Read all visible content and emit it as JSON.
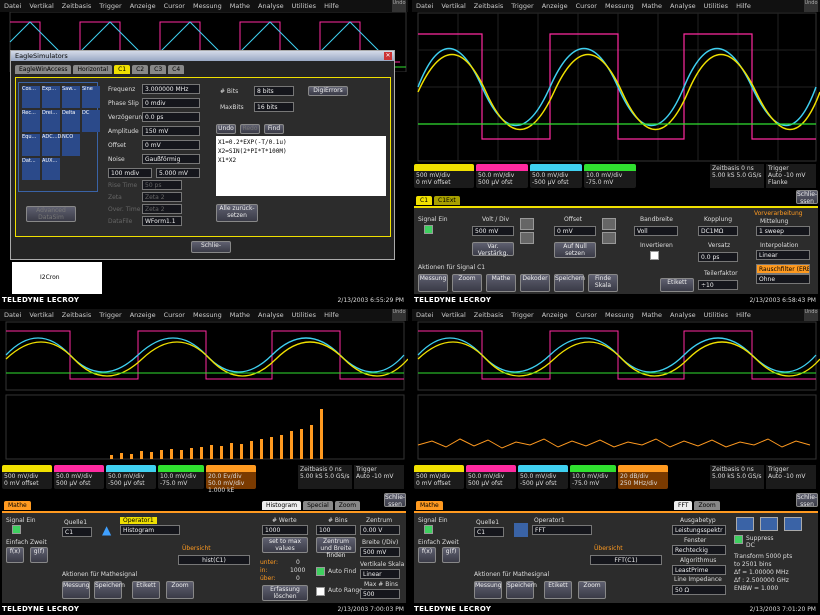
{
  "menu": [
    "Datei",
    "Vertikal",
    "Zeitbasis",
    "Trigger",
    "Anzeige",
    "Cursor",
    "Messung",
    "Mathe",
    "Analyse",
    "Utilities",
    "Hilfe"
  ],
  "undo": "Undo",
  "brand": "TELEDYNE LECROY",
  "colors": {
    "c1": "#f0e000",
    "c2": "#ff2aa0",
    "c3": "#3fd0f0",
    "c4": "#30e030",
    "math": "#ff9a20"
  },
  "timestamps": [
    "2/13/2003 6:55:29 PM",
    "2/13/2003 6:58:43 PM",
    "2/13/2003 7:00:03 PM",
    "2/13/2003 7:01:20 PM"
  ],
  "channels": [
    {
      "name": "C1",
      "coupling": "DC1M",
      "vdiv": "500 mV/div",
      "offset": "0 mV offset"
    },
    {
      "name": "C2",
      "coupling": "DC1M",
      "vdiv": "50.0 mV/div",
      "offset": "500 µV ofst"
    },
    {
      "name": "C3",
      "coupling": "DC1M",
      "vdiv": "50.0 mV/div",
      "offset": "-500 µV ofst"
    },
    {
      "name": "C4",
      "coupling": "DC1M",
      "vdiv": "10.0 mV/div",
      "offset": "-75.0 mV"
    }
  ],
  "timebase": {
    "label": "Zeitbasis",
    "value": "0 ns",
    "sr": "5.00 kS",
    "rate": "5.0 GS/s"
  },
  "trigger": {
    "label": "Trigger",
    "ch": "C1 DC",
    "mode": "Auto",
    "level": "-10 mV",
    "type": "Flanke",
    "slope": "Positiv"
  },
  "close_label": "Schlie-ssen",
  "q1": {
    "dialog_title": "EagleSimulators",
    "tabs": [
      "EagleWinAccess",
      "Horizontal",
      "C1",
      "C2",
      "C3",
      "C4"
    ],
    "wave_labels": [
      "Cos...",
      "Exp...",
      "Saw...",
      "Sine",
      "Rec...",
      "Drei...",
      "Delta",
      "DC",
      "Equ...",
      "ADC...Dat...",
      "NCO",
      "Dat...",
      "AUX..."
    ],
    "adv": "Advanced DataSim",
    "params": [
      {
        "label": "Frequenz",
        "value": "3.000000 MHz"
      },
      {
        "label": "Phase Slip",
        "value": "0 mdiv"
      },
      {
        "label": "Verzögerung",
        "value": "0.0 ps"
      },
      {
        "label": "Amplitude",
        "value": "150 mV"
      },
      {
        "label": "Offset",
        "value": "0 mV"
      },
      {
        "label": "Noise",
        "value": "Gaußförmig"
      }
    ],
    "noise_vals": [
      "100 mdiv",
      "5.000 mV"
    ],
    "dim": [
      "Rise Time",
      "Zeta",
      "Over. Time",
      "DataFile"
    ],
    "dim_vals": [
      "50 ps",
      "Zeta 2",
      "Zeta 2",
      "WForm1.1"
    ],
    "bits_label": "# Bits",
    "bits_val": "8 bits",
    "digerr": "DigiErrors",
    "maxbits_label": "MaxBits",
    "maxbits_val": "16 bits",
    "code_btns": [
      "Undo",
      "Redo",
      "Find"
    ],
    "code": [
      "X1=0.2*EXP(-T/0.1u)",
      "X2=SIN(2*PI*T*100M)",
      "X1*X2"
    ],
    "reset": "Alle zurück-setzen",
    "close": "Schlie-",
    "tree": [
      "I2Cron"
    ]
  },
  "q2": {
    "tabs": [
      "C1",
      "C1Ext"
    ],
    "signal_on": "Signal Ein",
    "vdiv_label": "Volt / Div",
    "vdiv": "500 mV",
    "offset_label": "Offset",
    "offset": "0 mV",
    "bw_label": "Bandbreite",
    "bw": "Voll",
    "coupling_label": "Kopplung",
    "coupling": "DC1MΩ",
    "var_label": "Var. Verstärkg.",
    "zero": "Auf Null setzen",
    "invert": "Invertieren",
    "skew_label": "Versatz",
    "skew": "0.0 ps",
    "pre_label": "Vorverarbeitung",
    "avg_label": "Mittelung",
    "avg": "1 sweep",
    "interp_label": "Interpolation",
    "interp": "Linear",
    "noise": "Rauschfilter (ERES)",
    "noise_val": "Ohne",
    "actions_label": "Aktionen für Signal C1",
    "actions": [
      "Messung",
      "Zoom",
      "Mathe",
      "Dekoder",
      "Speichern",
      "Finde Skala"
    ],
    "label_btn": "Etikett",
    "div_label": "Teilerfaktor",
    "div": "÷10"
  },
  "q3": {
    "tabs": [
      "Histogram",
      "Special",
      "Zoom"
    ],
    "math_tab": "Mathe",
    "signal_on": "Signal Ein",
    "simple": "Einfach",
    "dual": "Zweit",
    "src_label": "Quelle1",
    "src": "C1",
    "op_label": "Operator1",
    "op": "Histogram",
    "overview": "Übersicht",
    "ovval": "hist(C1)",
    "actions_label": "Aktionen für Mathesignal",
    "actions": [
      "Messung",
      "Speichern",
      "Etikett",
      "Zoom"
    ],
    "h1": "# Werte",
    "h1v": "1000",
    "setmax": "set to max values",
    "h2": "# Bins",
    "h2v": "100",
    "center": "Zentrum und Breite finden",
    "h3": "Zentrum",
    "h3v": "0.00 V",
    "width_label": "Breite (/Div)",
    "width": "500 mV",
    "vscale": "Vertikale Skala",
    "vscale_v": "Linear",
    "maxbin": "Max # Bins",
    "maxbin_v": "500",
    "under": "unter:",
    "in": "in:",
    "over": "über:",
    "in_v": "1000",
    "under_v": "0",
    "over_v": "0",
    "erase": "Erfassung löschen",
    "autofind": "Auto Find",
    "autorange": "Auto Range",
    "math_stat": {
      "name": "Math",
      "fn": "hist(C1)",
      "v1": "20.0 Ev/div",
      "v2": "50.0 mV/div",
      "v3": "1.000 kE"
    }
  },
  "q4": {
    "tabs": [
      "FFT",
      "Zoom"
    ],
    "math_tab": "Mathe",
    "signal_on": "Signal Ein",
    "simple": "Einfach",
    "dual": "Zweit",
    "src_label": "Quelle1",
    "src": "C1",
    "op_label": "Operator1",
    "op": "FFT",
    "overview": "Übersicht",
    "ovval": "FFT(C1)",
    "actions_label": "Aktionen für Mathesignal",
    "actions": [
      "Messung",
      "Speichern",
      "Etikett",
      "Zoom"
    ],
    "ausg": "Ausgabetyp",
    "ausg_v": "Leistungsspektr",
    "fenster": "Fenster",
    "fenster_v": "Rechteckig",
    "alg": "Algorithmus",
    "alg_v": "LeastPrime",
    "imp": "Line Impedance",
    "imp_v": "50 Ω",
    "suppress": "Suppress DC",
    "info": [
      "Transform 5000 pts",
      "to 2501 bins",
      "Δf = 1.00000 MHz",
      "Δf : 2.500000 GHz",
      "ENBW = 1.000"
    ],
    "math_stat": {
      "name": "Math",
      "fn": "FFT(C1)",
      "v1": "20 dB/div",
      "v2": "250 MHz/div",
      "v3": ""
    }
  }
}
